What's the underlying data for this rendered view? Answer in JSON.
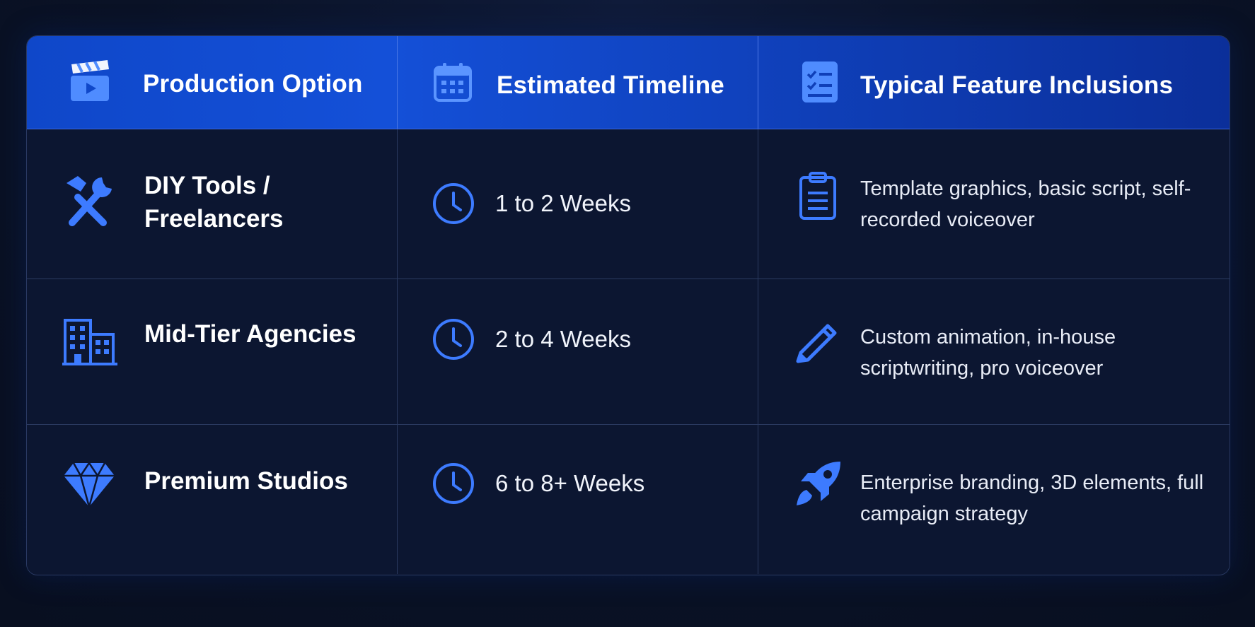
{
  "header": {
    "col1": "Production Option",
    "col2": "Estimated Timeline",
    "col3": "Typical Feature Inclusions",
    "icons": [
      "clapperboard-icon",
      "calendar-icon",
      "checklist-icon"
    ]
  },
  "rows": [
    {
      "option": "DIY Tools / Freelancers",
      "option_icon": "tools-icon",
      "timeline": "1 to 2 Weeks",
      "features": "Template graphics, basic script, self-recorded voiceover",
      "features_icon": "clipboard-icon"
    },
    {
      "option": "Mid-Tier Agencies",
      "option_icon": "building-icon",
      "timeline": "2 to 4 Weeks",
      "features": "Custom animation, in-house scriptwriting, pro voiceover",
      "features_icon": "pencil-icon"
    },
    {
      "option": "Premium Studios",
      "option_icon": "diamond-icon",
      "timeline": "6 to 8+ Weeks",
      "features": "Enterprise branding, 3D elements, full campaign strategy",
      "features_icon": "rocket-icon"
    }
  ],
  "colors": {
    "accent": "#3d7bff",
    "header_bg": "#1450d8",
    "page_bg": "#0a1226",
    "cell_bg": "#0c1631",
    "border": "#2b3a60"
  }
}
